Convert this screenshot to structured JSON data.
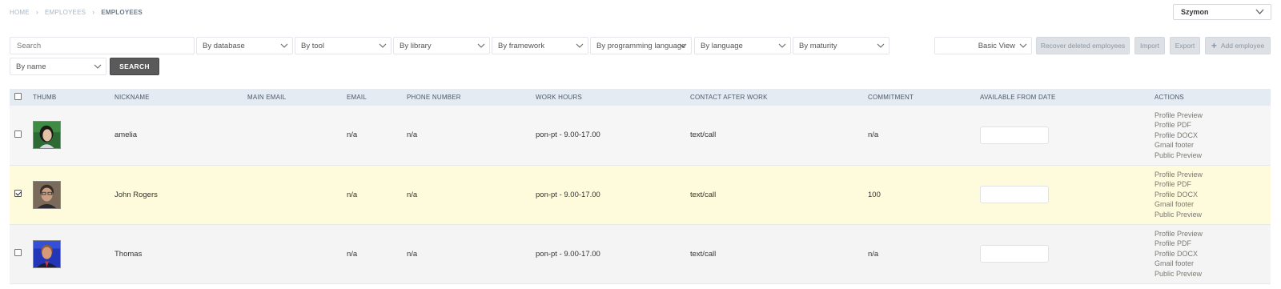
{
  "breadcrumb": {
    "home": "HOME",
    "employees": "EMPLOYEES",
    "current": "EMPLOYEES"
  },
  "user_menu": {
    "name": "Szymon"
  },
  "filters": {
    "search_placeholder": "Search",
    "by_database": "By database",
    "by_tool": "By tool",
    "by_library": "By library",
    "by_framework": "By framework",
    "by_programming_language": "By programming language",
    "by_language": "By language",
    "by_maturity": "By maturity",
    "by_name": "By name",
    "search_button": "SEARCH"
  },
  "toolbar": {
    "view": "Basic View",
    "recover": "Recover deleted employees",
    "import": "Import",
    "export": "Export",
    "add": "Add employee"
  },
  "table": {
    "headers": {
      "thumb": "THUMB",
      "nickname": "NICKNAME",
      "main_email": "MAIN EMAIL",
      "email": "EMAIL",
      "phone": "PHONE NUMBER",
      "work_hours": "WORK HOURS",
      "contact": "CONTACT AFTER WORK",
      "commitment": "COMMITMENT",
      "available": "AVAILABLE FROM DATE",
      "actions": "ACTIONS"
    },
    "action_labels": {
      "profile_preview": "Profile Preview",
      "profile_pdf": "Profile PDF",
      "profile_docx": "Profile DOCX",
      "gmail_footer": "Gmail footer",
      "public_preview": "Public Preview"
    },
    "rows": [
      {
        "checked": false,
        "nickname": "amelia",
        "main_email": "",
        "email": "n/a",
        "phone": "n/a",
        "work_hours": "pon-pt - 9.00-17.00",
        "contact": "text/call",
        "commitment": "n/a",
        "available": ""
      },
      {
        "checked": true,
        "nickname": "John Rogers",
        "main_email": "",
        "email": "n/a",
        "phone": "n/a",
        "work_hours": "pon-pt - 9.00-17.00",
        "contact": "text/call",
        "commitment": "100",
        "available": ""
      },
      {
        "checked": false,
        "nickname": "Thomas",
        "main_email": "",
        "email": "n/a",
        "phone": "n/a",
        "work_hours": "pon-pt - 9.00-17.00",
        "contact": "text/call",
        "commitment": "n/a",
        "available": ""
      }
    ]
  }
}
